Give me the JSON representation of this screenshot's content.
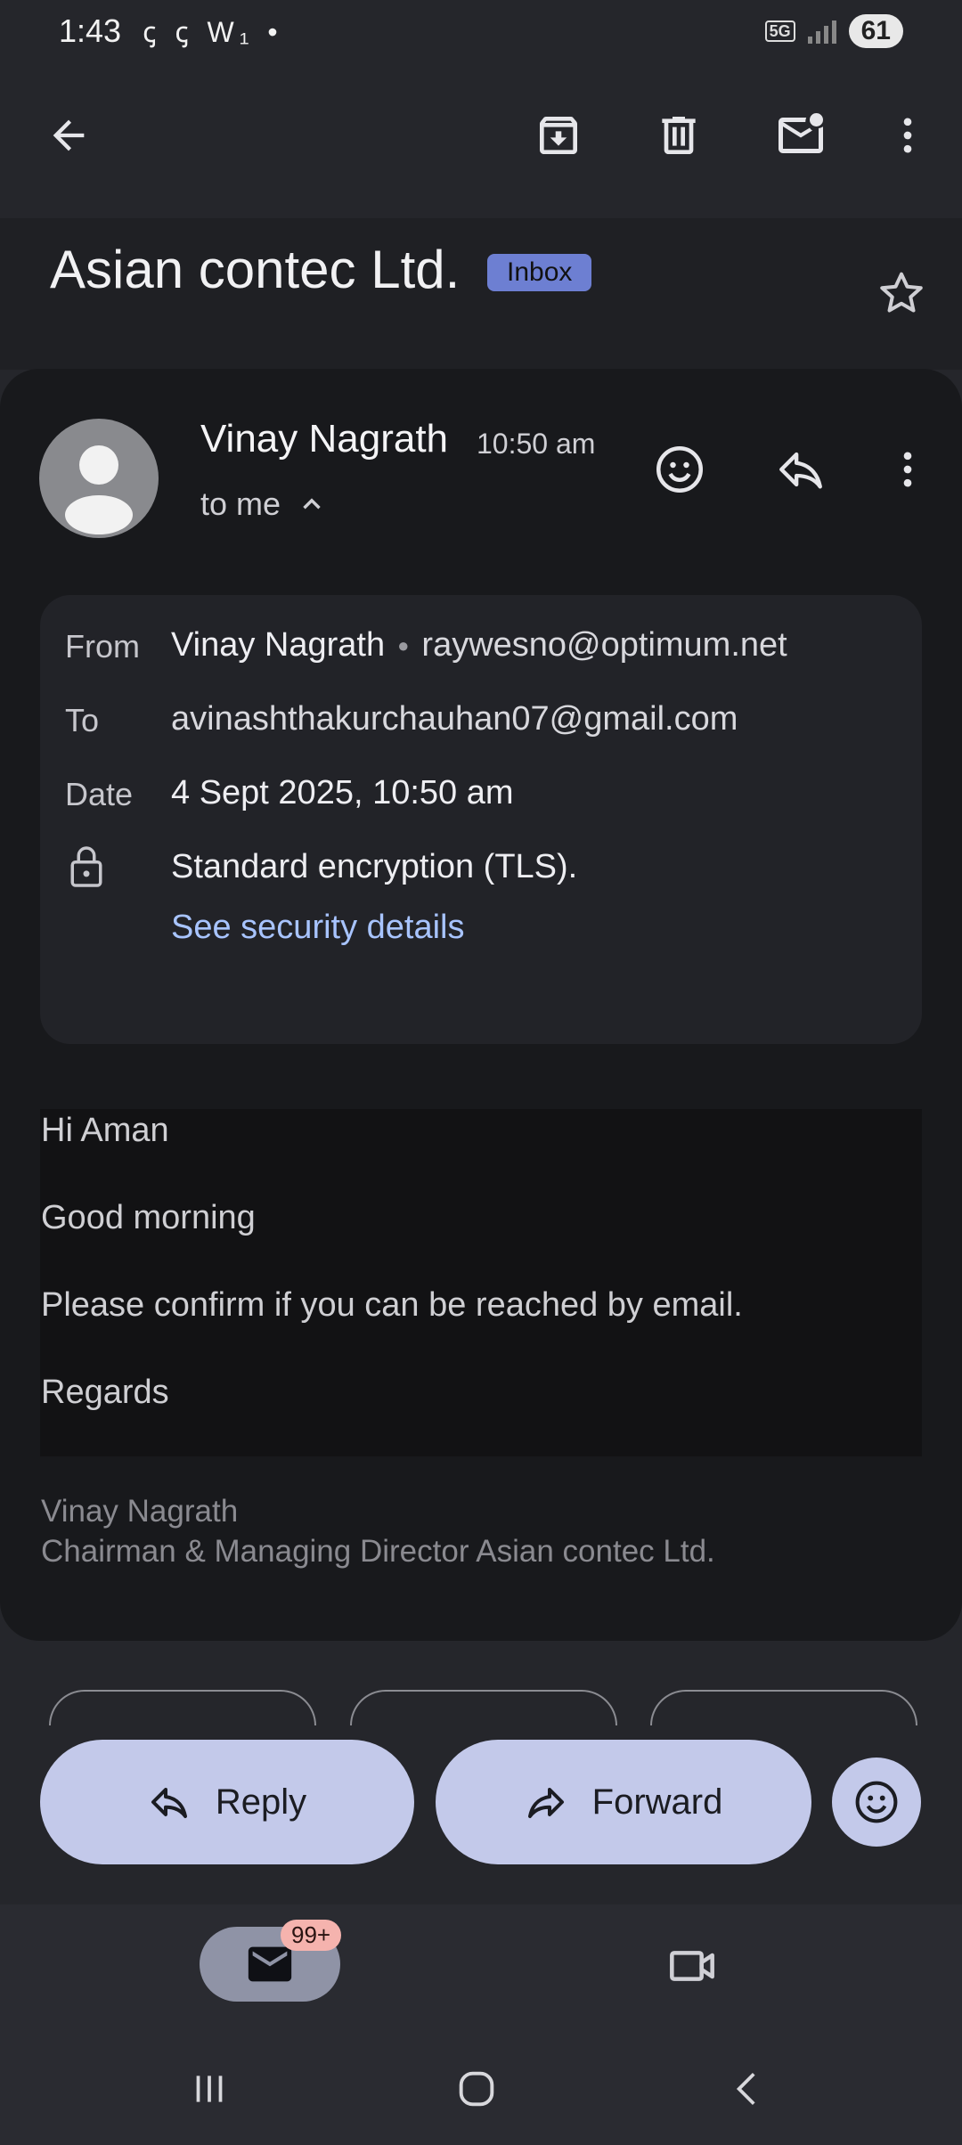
{
  "status": {
    "time": "1:43",
    "left_icons": "ꞔ ꞔ W₁ •",
    "network": "5G",
    "battery": "61"
  },
  "toolbar": {
    "back": "back",
    "archive": "archive",
    "delete": "delete",
    "mark_unread": "mark unread",
    "more": "more options"
  },
  "email": {
    "subject": "Asian contec Ltd.",
    "label": "Inbox",
    "sender_name": "Vinay Nagrath",
    "time": "10:50 am",
    "to_me": "to me",
    "details": {
      "from_label": "From",
      "from_name": "Vinay Nagrath",
      "from_email": "raywesno@optimum.net",
      "to_label": "To",
      "to_value": "avinashthakurchauhan07@gmail.com",
      "date_label": "Date",
      "date_value": "4 Sept 2025, 10:50 am",
      "encryption": "Standard encryption (TLS).",
      "security_link": "See security details"
    },
    "body": {
      "line1": "Hi Aman",
      "line2": "Good morning",
      "line3": "Please confirm if you can be reached by email.",
      "line4": "Regards"
    },
    "signature": {
      "name": "Vinay Nagrath",
      "title": "Chairman & Managing Director  Asian contec Ltd."
    }
  },
  "actions": {
    "reply_label": "Reply",
    "forward_label": "Forward"
  },
  "bottom_nav": {
    "mail_badge": "99+"
  },
  "colors": {
    "background": "#25262b",
    "card": "#18191c",
    "accent_button": "#c3c9ea",
    "link": "#a8c4ff",
    "inbox_label": "#6d7fd2",
    "badge": "#f5b3ae"
  }
}
